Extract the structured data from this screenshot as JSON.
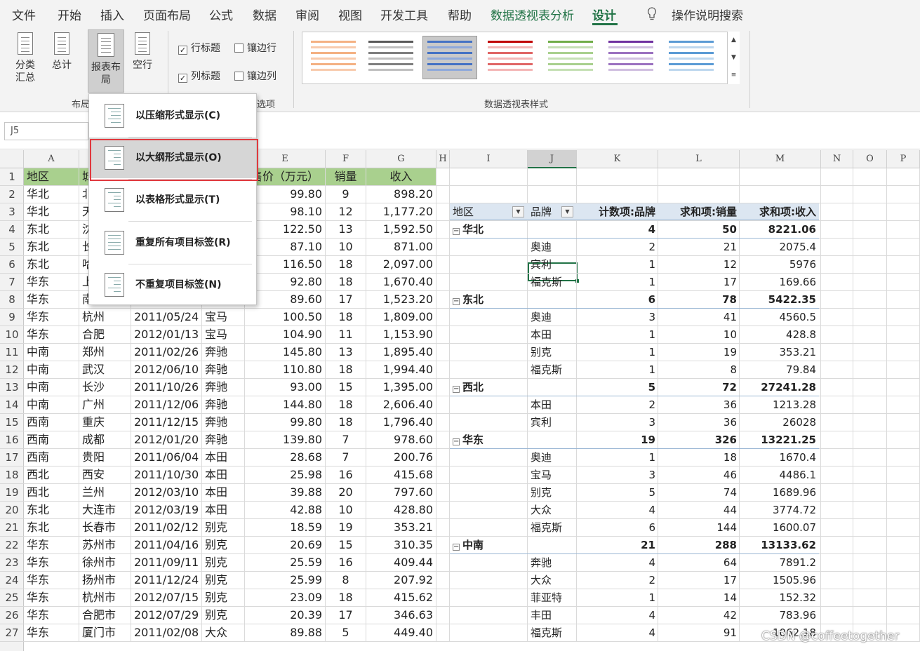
{
  "tabs": [
    "文件",
    "开始",
    "插入",
    "页面布局",
    "公式",
    "数据",
    "审阅",
    "视图",
    "开发工具",
    "帮助",
    "数据透视表分析",
    "设计"
  ],
  "tell_me": "操作说明搜索",
  "ribbon": {
    "subtotals": "分类汇总",
    "grand_totals": "总计",
    "report_layout": "报表布局",
    "blank_rows": "空行",
    "row_headers": "行标题",
    "banded_rows": "镶边行",
    "col_headers": "列标题",
    "banded_cols": "镶边列",
    "group_layout": "布局",
    "group_options": "选项",
    "group_styles": "数据透视表样式"
  },
  "menu": {
    "items": [
      "以压缩形式显示(C)",
      "以大纲形式显示(O)",
      "以表格形式显示(T)",
      "重复所有项目标签(R)",
      "不重复项目标签(N)"
    ]
  },
  "name_box": "J5",
  "columns": [
    "A",
    "",
    "",
    "",
    "E",
    "F",
    "G",
    "H",
    "I",
    "J",
    "K",
    "L",
    "M",
    "N",
    "O",
    "P"
  ],
  "row_numbers": [
    "1",
    "2",
    "3",
    "4",
    "5",
    "6",
    "7",
    "8",
    "9",
    "10",
    "11",
    "12",
    "13",
    "14",
    "15",
    "16",
    "17",
    "18",
    "19",
    "20",
    "21",
    "22",
    "23",
    "24",
    "25",
    "26",
    "27"
  ],
  "table": {
    "header": [
      "地区",
      "城",
      "",
      "",
      "售价（万元）",
      "销量",
      "收入"
    ],
    "rows": [
      [
        "华北",
        "北",
        "",
        "",
        "99.80",
        "9",
        "898.20"
      ],
      [
        "华北",
        "天",
        "",
        "",
        "98.10",
        "12",
        "1,177.20"
      ],
      [
        "东北",
        "沈",
        "",
        "",
        "122.50",
        "13",
        "1,592.50"
      ],
      [
        "东北",
        "长",
        "",
        "",
        "87.10",
        "10",
        "871.00"
      ],
      [
        "东北",
        "哈",
        "",
        "",
        "116.50",
        "18",
        "2,097.00"
      ],
      [
        "华东",
        "上",
        "",
        "",
        "92.80",
        "18",
        "1,670.40"
      ],
      [
        "华东",
        "南京",
        "2011/04/29",
        "宝马",
        "89.60",
        "17",
        "1,523.20"
      ],
      [
        "华东",
        "杭州",
        "2011/05/24",
        "宝马",
        "100.50",
        "18",
        "1,809.00"
      ],
      [
        "华东",
        "合肥",
        "2012/01/13",
        "宝马",
        "104.90",
        "11",
        "1,153.90"
      ],
      [
        "中南",
        "郑州",
        "2011/02/26",
        "奔驰",
        "145.80",
        "13",
        "1,895.40"
      ],
      [
        "中南",
        "武汉",
        "2012/06/10",
        "奔驰",
        "110.80",
        "18",
        "1,994.40"
      ],
      [
        "中南",
        "长沙",
        "2011/10/26",
        "奔驰",
        "93.00",
        "15",
        "1,395.00"
      ],
      [
        "中南",
        "广州",
        "2011/12/06",
        "奔驰",
        "144.80",
        "18",
        "2,606.40"
      ],
      [
        "西南",
        "重庆",
        "2011/12/15",
        "奔驰",
        "99.80",
        "18",
        "1,796.40"
      ],
      [
        "西南",
        "成都",
        "2012/01/20",
        "奔驰",
        "139.80",
        "7",
        "978.60"
      ],
      [
        "西南",
        "贵阳",
        "2011/06/04",
        "本田",
        "28.68",
        "7",
        "200.76"
      ],
      [
        "西北",
        "西安",
        "2011/10/30",
        "本田",
        "25.98",
        "16",
        "415.68"
      ],
      [
        "西北",
        "兰州",
        "2012/03/10",
        "本田",
        "39.88",
        "20",
        "797.60"
      ],
      [
        "东北",
        "大连市",
        "2012/03/19",
        "本田",
        "42.88",
        "10",
        "428.80"
      ],
      [
        "东北",
        "长春市",
        "2011/02/12",
        "别克",
        "18.59",
        "19",
        "353.21"
      ],
      [
        "华东",
        "苏州市",
        "2011/04/16",
        "别克",
        "20.69",
        "15",
        "310.35"
      ],
      [
        "华东",
        "徐州市",
        "2011/09/11",
        "别克",
        "25.59",
        "16",
        "409.44"
      ],
      [
        "华东",
        "扬州市",
        "2011/12/24",
        "别克",
        "25.99",
        "8",
        "207.92"
      ],
      [
        "华东",
        "杭州市",
        "2012/07/15",
        "别克",
        "23.09",
        "18",
        "415.62"
      ],
      [
        "华东",
        "合肥市",
        "2012/07/29",
        "别克",
        "20.39",
        "17",
        "346.63"
      ],
      [
        "华东",
        "厦门市",
        "2011/02/08",
        "大众",
        "89.88",
        "5",
        "449.40"
      ]
    ]
  },
  "pivot": {
    "headers": [
      "地区",
      "品牌",
      "计数项:品牌",
      "求和项:销量",
      "求和项:收入"
    ],
    "rows": [
      {
        "region": "华北",
        "brand": "",
        "count": "4",
        "qty": "50",
        "rev": "8221.06",
        "group": true
      },
      {
        "region": "",
        "brand": "奥迪",
        "count": "2",
        "qty": "21",
        "rev": "2075.4"
      },
      {
        "region": "",
        "brand": "宾利",
        "count": "1",
        "qty": "12",
        "rev": "5976"
      },
      {
        "region": "",
        "brand": "福克斯",
        "count": "1",
        "qty": "17",
        "rev": "169.66"
      },
      {
        "region": "东北",
        "brand": "",
        "count": "6",
        "qty": "78",
        "rev": "5422.35",
        "group": true
      },
      {
        "region": "",
        "brand": "奥迪",
        "count": "3",
        "qty": "41",
        "rev": "4560.5"
      },
      {
        "region": "",
        "brand": "本田",
        "count": "1",
        "qty": "10",
        "rev": "428.8"
      },
      {
        "region": "",
        "brand": "别克",
        "count": "1",
        "qty": "19",
        "rev": "353.21"
      },
      {
        "region": "",
        "brand": "福克斯",
        "count": "1",
        "qty": "8",
        "rev": "79.84"
      },
      {
        "region": "西北",
        "brand": "",
        "count": "5",
        "qty": "72",
        "rev": "27241.28",
        "group": true
      },
      {
        "region": "",
        "brand": "本田",
        "count": "2",
        "qty": "36",
        "rev": "1213.28"
      },
      {
        "region": "",
        "brand": "宾利",
        "count": "3",
        "qty": "36",
        "rev": "26028"
      },
      {
        "region": "华东",
        "brand": "",
        "count": "19",
        "qty": "326",
        "rev": "13221.25",
        "group": true
      },
      {
        "region": "",
        "brand": "奥迪",
        "count": "1",
        "qty": "18",
        "rev": "1670.4"
      },
      {
        "region": "",
        "brand": "宝马",
        "count": "3",
        "qty": "46",
        "rev": "4486.1"
      },
      {
        "region": "",
        "brand": "别克",
        "count": "5",
        "qty": "74",
        "rev": "1689.96"
      },
      {
        "region": "",
        "brand": "大众",
        "count": "4",
        "qty": "44",
        "rev": "3774.72"
      },
      {
        "region": "",
        "brand": "福克斯",
        "count": "6",
        "qty": "144",
        "rev": "1600.07"
      },
      {
        "region": "中南",
        "brand": "",
        "count": "21",
        "qty": "288",
        "rev": "13133.62",
        "group": true
      },
      {
        "region": "",
        "brand": "奔驰",
        "count": "4",
        "qty": "64",
        "rev": "7891.2"
      },
      {
        "region": "",
        "brand": "大众",
        "count": "2",
        "qty": "17",
        "rev": "1505.96"
      },
      {
        "region": "",
        "brand": "菲亚特",
        "count": "1",
        "qty": "14",
        "rev": "152.32"
      },
      {
        "region": "",
        "brand": "丰田",
        "count": "4",
        "qty": "42",
        "rev": "783.96"
      },
      {
        "region": "",
        "brand": "福克斯",
        "count": "4",
        "qty": "91",
        "rev": "1062.18"
      }
    ]
  },
  "watermark": "CSDN @coffeetogether",
  "colors": {
    "accent": "#217346",
    "header_fill": "#a9d08e",
    "pivot_header": "#dce6f1",
    "highlight_border": "#e0393e"
  }
}
